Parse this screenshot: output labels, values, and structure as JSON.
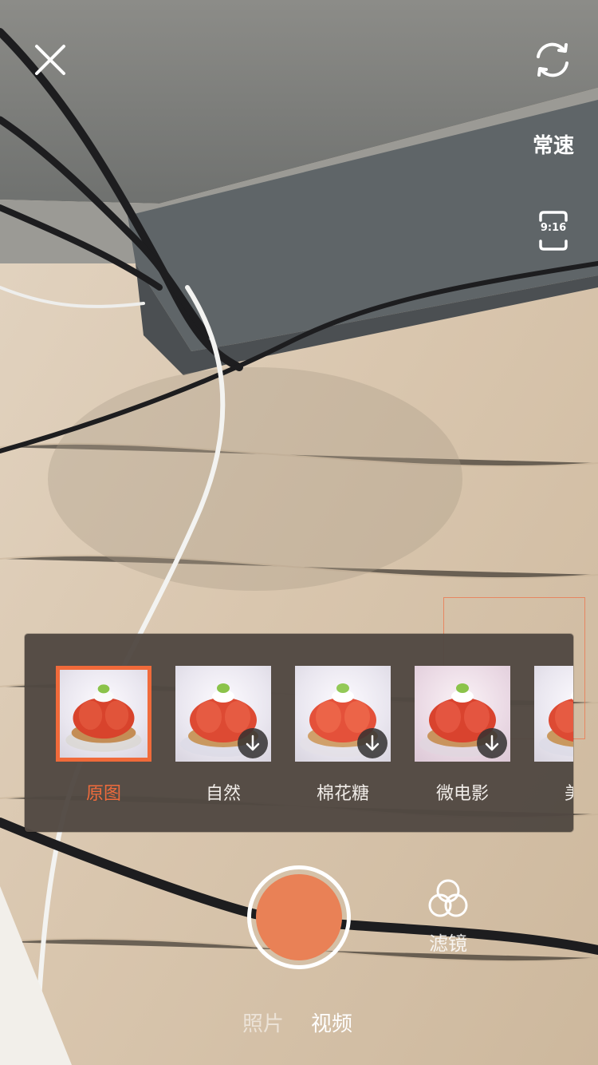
{
  "top_bar": {
    "speed_label": "常速",
    "ratio_label": "9:16"
  },
  "filters": [
    {
      "label": "原图",
      "selected": true,
      "downloadable": false
    },
    {
      "label": "自然",
      "selected": false,
      "downloadable": true
    },
    {
      "label": "棉花糖",
      "selected": false,
      "downloadable": true
    },
    {
      "label": "微电影",
      "selected": false,
      "downloadable": true
    },
    {
      "label": "美",
      "selected": false,
      "downloadable": false
    }
  ],
  "bottom": {
    "filter_button_label": "滤镜",
    "mode_photo": "照片",
    "mode_video": "视频",
    "active_mode": "视频"
  },
  "colors": {
    "accent": "#ef6b3c",
    "shutter": "#e98156"
  },
  "icons": [
    "close-icon",
    "camera-switch-icon",
    "aspect-ratio-icon",
    "download-icon",
    "filter-circles-icon"
  ]
}
